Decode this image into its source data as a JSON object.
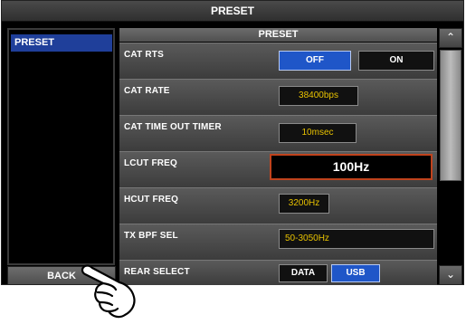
{
  "window": {
    "title": "PRESET"
  },
  "sidebar": {
    "items": [
      {
        "label": "PRESET",
        "selected": true
      }
    ],
    "back_label": "BACK"
  },
  "main": {
    "header": "PRESET",
    "rows": [
      {
        "label": "CAT RTS",
        "options": [
          "OFF",
          "ON"
        ],
        "selected": "OFF"
      },
      {
        "label": "CAT RATE",
        "value": "38400bps"
      },
      {
        "label": "CAT TIME OUT TIMER",
        "value": "10msec"
      },
      {
        "label": "LCUT FREQ",
        "value": "100Hz"
      },
      {
        "label": "HCUT FREQ",
        "value": "3200Hz"
      },
      {
        "label": "TX BPF SEL",
        "value": "50-3050Hz"
      },
      {
        "label": "REAR SELECT",
        "options": [
          "DATA",
          "USB"
        ],
        "selected": "USB"
      }
    ]
  },
  "scrollbar": {
    "up_icon": "chevron-up-icon",
    "down_icon": "chevron-down-icon"
  },
  "colors": {
    "accent": "#1f56c8",
    "value_text": "#e8c200",
    "focus_border": "#c0431d"
  }
}
